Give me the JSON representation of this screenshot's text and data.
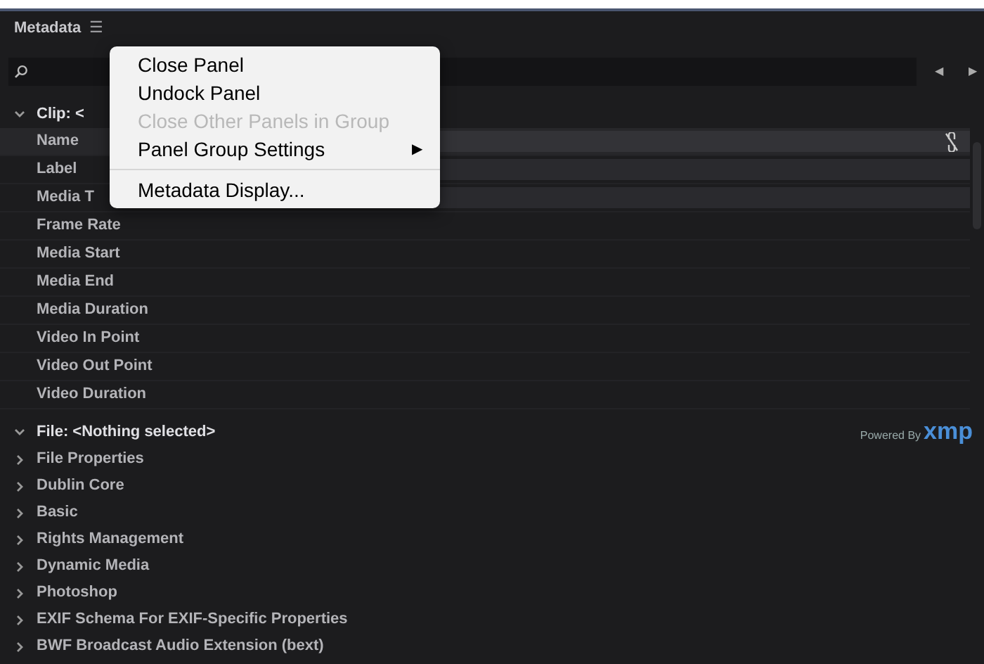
{
  "panel": {
    "title": "Metadata",
    "menu_glyph": "☰"
  },
  "nav_buttons": [
    "◀",
    "▶"
  ],
  "sections": [
    {
      "label": "Clip: <",
      "expanded": true,
      "children": [
        {
          "label": "Name",
          "has_field": true,
          "selected": true
        },
        {
          "label": "Label",
          "has_field": true,
          "selected": false
        },
        {
          "label": "Media T",
          "has_field": true,
          "selected": false
        },
        {
          "label": "Frame Rate",
          "has_field": false,
          "selected": false
        },
        {
          "label": "Media Start",
          "has_field": false,
          "selected": false
        },
        {
          "label": "Media End",
          "has_field": false,
          "selected": false
        },
        {
          "label": "Media Duration",
          "has_field": false,
          "selected": false
        },
        {
          "label": "Video In Point",
          "has_field": false,
          "selected": false
        },
        {
          "label": "Video Out Point",
          "has_field": false,
          "selected": false
        },
        {
          "label": "Video Duration",
          "has_field": false,
          "selected": false
        }
      ]
    },
    {
      "label": "File: <Nothing selected>",
      "expanded": true,
      "badge": {
        "prefix": "Powered By",
        "brand": "xmp"
      },
      "children": [
        {
          "label": "File Properties",
          "expanded": false
        },
        {
          "label": "Dublin Core",
          "expanded": false
        },
        {
          "label": "Basic",
          "expanded": false
        },
        {
          "label": "Rights Management",
          "expanded": false
        },
        {
          "label": "Dynamic Media",
          "expanded": false
        },
        {
          "label": "Photoshop",
          "expanded": false
        },
        {
          "label": "EXIF Schema For EXIF-Specific Properties",
          "expanded": false
        },
        {
          "label": "BWF Broadcast Audio Extension (bext)",
          "expanded": false
        }
      ]
    }
  ],
  "context_menu": [
    {
      "kind": "item",
      "label": "Close Panel",
      "disabled": false
    },
    {
      "kind": "item",
      "label": "Undock Panel",
      "disabled": false
    },
    {
      "kind": "item",
      "label": "Close Other Panels in Group",
      "disabled": true
    },
    {
      "kind": "submenu",
      "label": "Panel Group Settings",
      "arrow": "▶",
      "disabled": false
    },
    {
      "kind": "separator"
    },
    {
      "kind": "item",
      "label": "Metadata Display...",
      "disabled": false
    }
  ]
}
